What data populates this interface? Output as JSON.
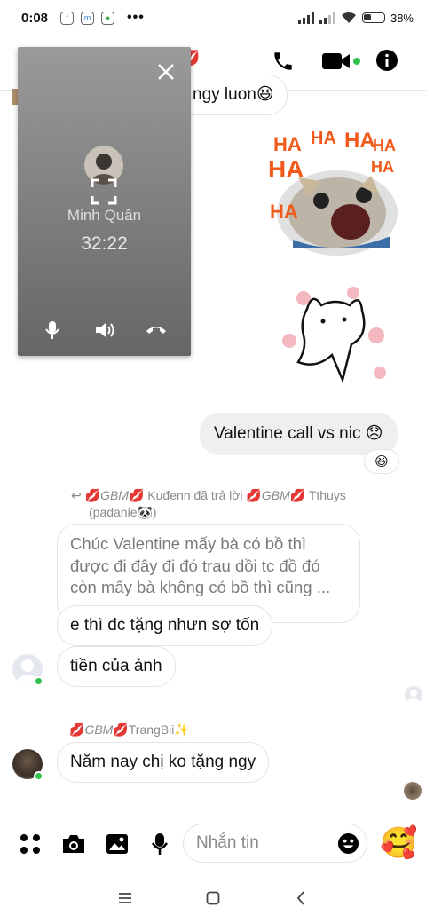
{
  "status_bar": {
    "time": "0:08",
    "more": "•••",
    "battery": "38%"
  },
  "header": {
    "partial_text": "💋"
  },
  "call_window": {
    "caller_name": "Minh Quân",
    "duration": "32:22"
  },
  "messages": {
    "prev_tail": "ngy luon😆",
    "sent_text": "Valentine call vs nic 😞",
    "sent_reaction": "😆",
    "reply_meta_line1_a": "GBM",
    "reply_meta_line1_b": " Kuđenn đã trả lời ",
    "reply_meta_line1_c": "GBM",
    "reply_meta_line1_d": " Tthuys",
    "reply_meta_line2": "(padanie🐼)",
    "quoted_text": "Chúc Valentine mấy bà có bồ thì được đi đây đi đó trau dồi tc đồ đó còn mấy bà không có bồ thì cũng ...",
    "reply_1": "e thì đc tặng nhưn sợ tốn",
    "reply_2": "tiền của ảnh",
    "sender2_gbm": "GBM",
    "sender2_name": "TrangBii✨",
    "reply_3": "Năm nay chị ko tặng ngy"
  },
  "composer": {
    "placeholder": "Nhắn tin",
    "emoji": "🥰"
  },
  "colors": {
    "online": "#31c24d",
    "heart": "#d83a5a"
  }
}
